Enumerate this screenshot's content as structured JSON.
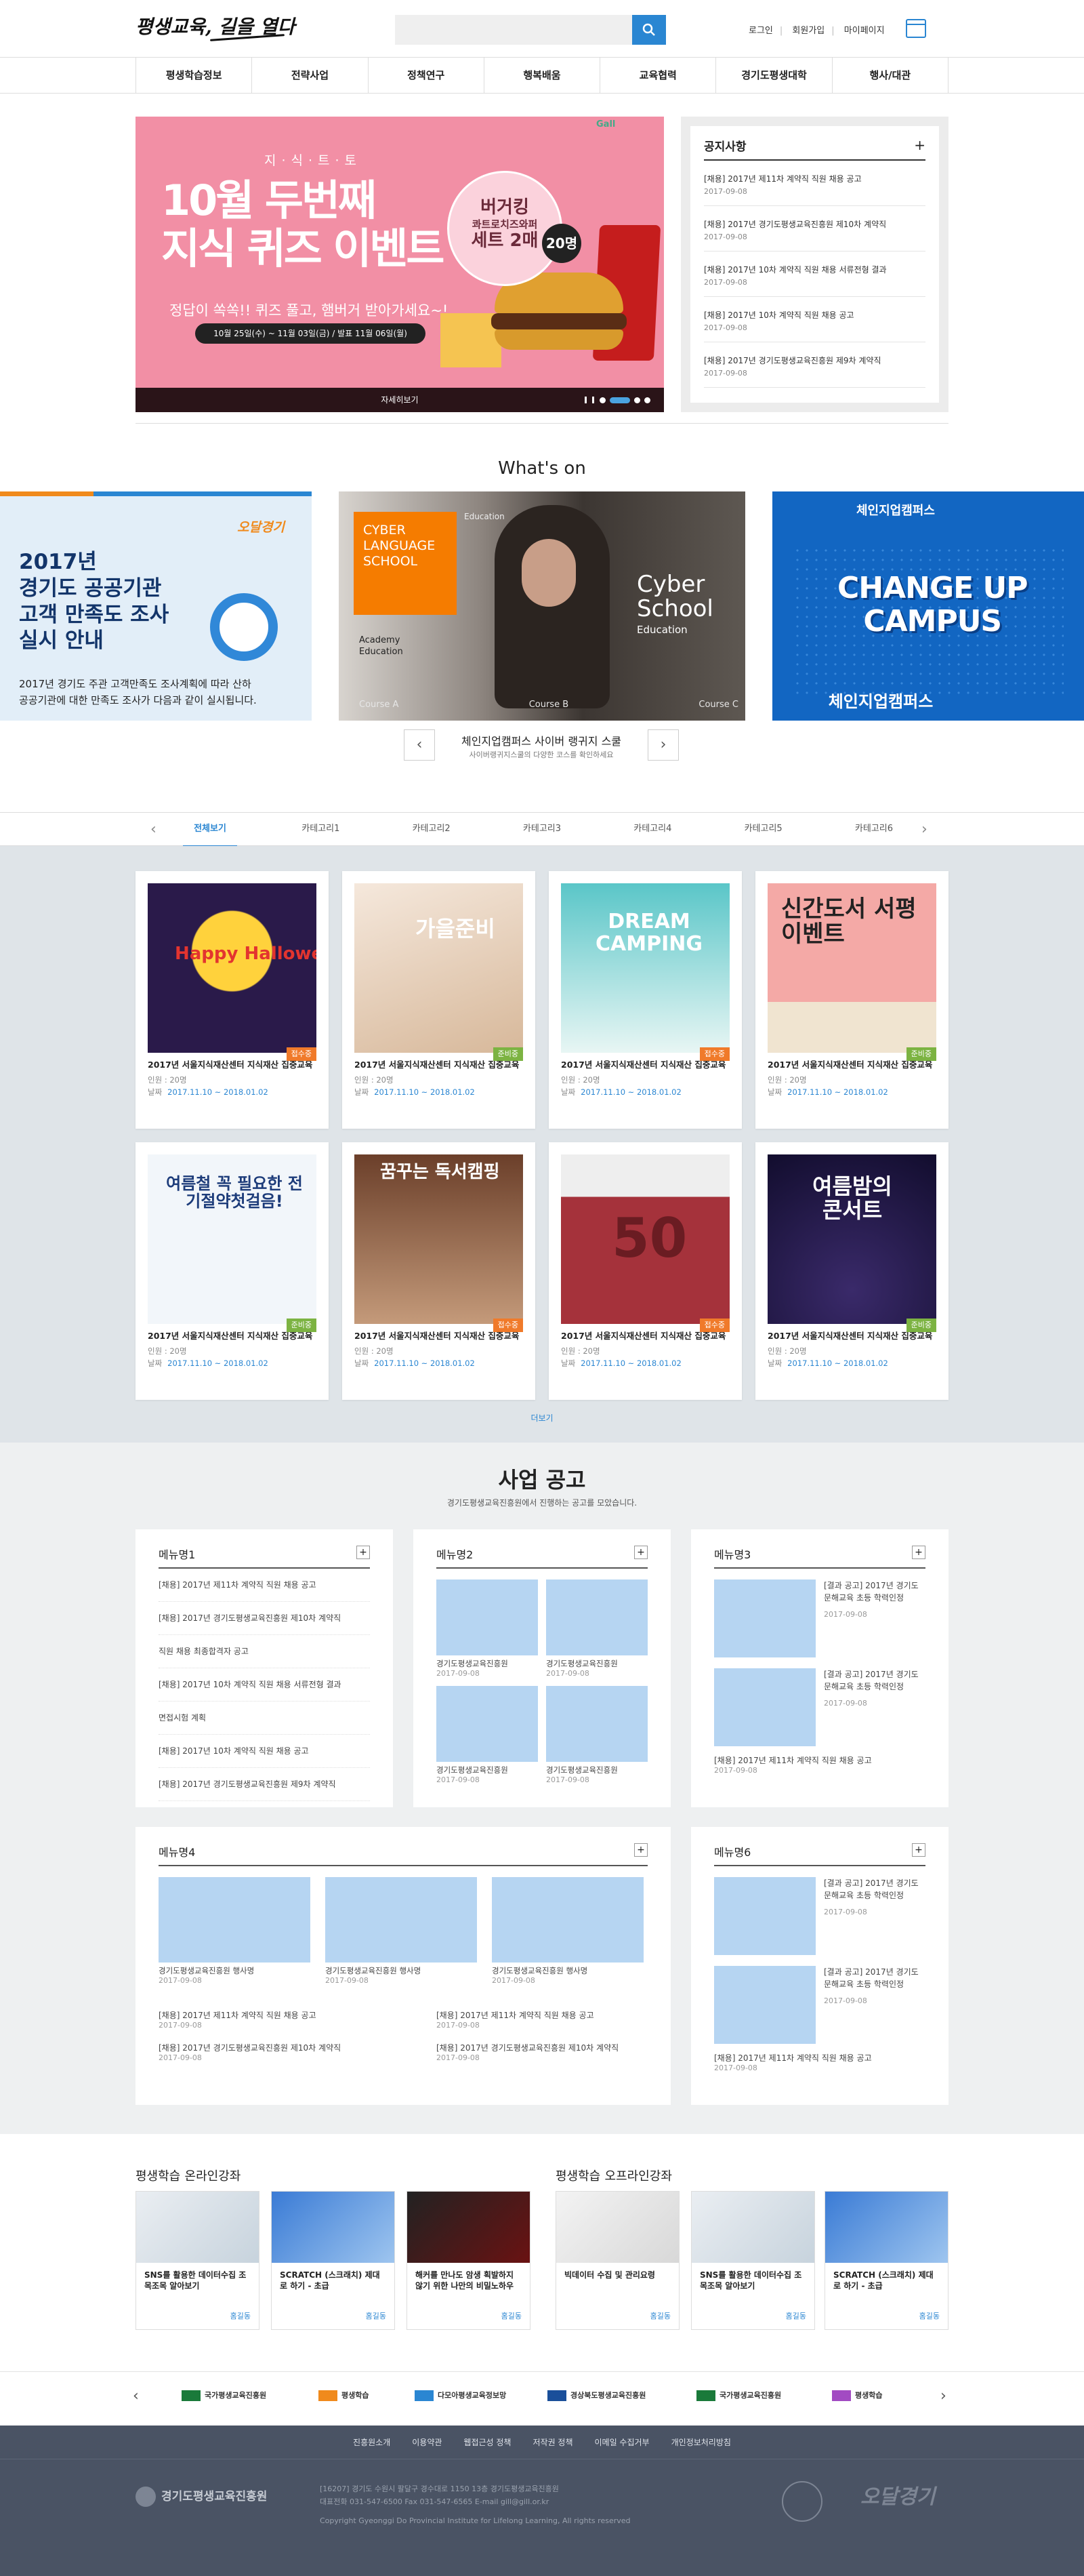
{
  "header": {
    "logo": "평생교육, 길을 열다",
    "search_placeholder": "",
    "links": [
      "로그인",
      "회원가입",
      "마이페이지"
    ]
  },
  "nav": [
    "평생학습정보",
    "전략사업",
    "정책연구",
    "행복배움",
    "교육협력",
    "경기도평생대학",
    "행사/대관"
  ],
  "banner": {
    "sub": "지·식·트·토",
    "title_line1": "10월 두번째",
    "title_line2": "지식 퀴즈 이벤트",
    "tagline": "정답이 쏙쏙!! 퀴즈 풀고, 햄버거 받아가세요~!",
    "period": "10월 25일(수) ~ 11월 03일(금) / 발표 11월 06일(월)",
    "prize_1": "버거킹",
    "prize_2": "콰트로치즈와퍼",
    "prize_3": "세트 2매",
    "prize_count": "20명",
    "brand": "Gall",
    "more": "자세히보기"
  },
  "notice": {
    "title": "공지사항",
    "plus": "+",
    "items": [
      {
        "title": "[채용] 2017년 제11차 계약직 직원 채용 공고",
        "date": "2017-09-08"
      },
      {
        "title": "[채용] 2017년 경기도평생교육진흥원 제10차 계약직",
        "date": "2017-09-08"
      },
      {
        "title": "[채용] 2017년 10차 계약직 직원 채용 서류전형 결과",
        "date": "2017-09-08"
      },
      {
        "title": "[채용] 2017년 10차 계약직 직원 채용 공고",
        "date": "2017-09-08"
      },
      {
        "title": "[채용] 2017년 경기도평생교육진흥원 제9차 계약직",
        "date": "2017-09-08"
      }
    ]
  },
  "whatson": {
    "title": "What's on",
    "left": {
      "logo": "오달경기",
      "title_1": "2017년",
      "title_2": "경기도 공공기관",
      "title_3": "고객 만족도 조사",
      "title_4": "실시 안내",
      "desc_1": "2017년 경기도 주관 고객만족도 조사계획에 따라 산하",
      "desc_2": "공공기관에 대한 만족도 조사가 다음과 같이 실시됩니다."
    },
    "center": {
      "box_1": "CYBER",
      "box_2": "LANGUAGE",
      "box_3": "SCHOOL",
      "edu": "Education",
      "cs_1": "Cyber",
      "cs_2": "School",
      "cs_3": "Education",
      "acad_1": "Academy",
      "acad_2": "Education",
      "course_a": "Course A",
      "course_b": "Course B",
      "course_c": "Course C"
    },
    "right": {
      "top": "체인지업캠퍼스",
      "line_1": "CHANGE UP",
      "line_2": "CAMPUS",
      "bottom": "체인지업캠퍼스"
    },
    "caption": "체인지업캠퍼스 사이버 랭귀지 스쿨",
    "caption_sub": "사이버랭귀지스쿨의 다양한 코스를 확인하세요",
    "prev": "‹",
    "next": "›"
  },
  "tabs": [
    "전체보기",
    "카테고리1",
    "카테고리2",
    "카테고리3",
    "카테고리4",
    "카테고리5",
    "카테고리6"
  ],
  "cards": [
    {
      "img_text": "Happy Halloween",
      "tag": "접수중",
      "title": "2017년 서울지식재산센터 지식재산 집중교육",
      "count": "인원 : 20명",
      "date_label": "날짜",
      "date": "2017.11.10 ~ 2018.01.02"
    },
    {
      "img_text": "가을준비",
      "tag": "준비중",
      "title": "2017년 서울지식재산센터 지식재산 집중교육",
      "count": "인원 : 20명",
      "date_label": "날짜",
      "date": "2017.11.10 ~ 2018.01.02"
    },
    {
      "img_text": "DREAM CAMPING",
      "tag": "접수중",
      "title": "2017년 서울지식재산센터 지식재산 집중교육",
      "count": "인원 : 20명",
      "date_label": "날짜",
      "date": "2017.11.10 ~ 2018.01.02"
    },
    {
      "img_text": "신간도서 서평이벤트",
      "tag": "준비중",
      "title": "2017년 서울지식재산센터 지식재산 집중교육",
      "count": "인원 : 20명",
      "date_label": "날짜",
      "date": "2017.11.10 ~ 2018.01.02"
    },
    {
      "img_text": "여름철 꼭 필요한 전기절약첫걸음!",
      "tag": "준비중",
      "title": "2017년 서울지식재산센터 지식재산 집중교육",
      "count": "인원 : 20명",
      "date_label": "날짜",
      "date": "2017.11.10 ~ 2018.01.02"
    },
    {
      "img_text": "꿈꾸는 독서캠핑",
      "tag": "접수중",
      "title": "2017년 서울지식재산센터 지식재산 집중교육",
      "count": "인원 : 20명",
      "date_label": "날짜",
      "date": "2017.11.10 ~ 2018.01.02"
    },
    {
      "img_text": "50",
      "tag": "접수중",
      "title": "2017년 서울지식재산센터 지식재산 집중교육",
      "count": "인원 : 20명",
      "date_label": "날짜",
      "date": "2017.11.10 ~ 2018.01.02"
    },
    {
      "img_text": "여름밤의 콘서트",
      "tag": "준비중",
      "title": "2017년 서울지식재산센터 지식재산 집중교육",
      "count": "인원 : 20명",
      "date_label": "날짜",
      "date": "2017.11.10 ~ 2018.01.02"
    }
  ],
  "more": "더보기",
  "announce": {
    "title": "사업 공고",
    "sub": "경기도평생교육진흥원에서 진행하는 공고를 모았습니다.",
    "menu1": {
      "title": "메뉴명1",
      "items": [
        "[채용] 2017년 제11차 계약직 직원 채용 공고",
        "[채용] 2017년 경기도평생교육진흥원 제10차 계약직",
        "직원 채용 최종합격자 공고",
        "[채용] 2017년 10차 계약직 직원 채용 서류전형 결과",
        "면접시험 계획",
        "[채용] 2017년 10차 계약직 직원 채용 공고",
        "[채용] 2017년 경기도평생교육진흥원 제9차 계약직"
      ]
    },
    "menu2": {
      "title": "메뉴명2",
      "items": [
        {
          "cap": "경기도평생교육진흥원",
          "date": "2017-09-08"
        },
        {
          "cap": "경기도평생교육진흥원",
          "date": "2017-09-08"
        },
        {
          "cap": "경기도평생교육진흥원",
          "date": "2017-09-08"
        },
        {
          "cap": "경기도평생교육진흥원",
          "date": "2017-09-08"
        }
      ]
    },
    "menu3": {
      "title": "메뉴명3",
      "items": [
        {
          "text": "[결과 공고] 2017년 경기도 문해교육 초등 학력인정",
          "date": "2017-09-08"
        },
        {
          "text": "[결과 공고] 2017년 경기도 문해교육 초등 학력인정",
          "date": "2017-09-08"
        }
      ],
      "foot": "[채용] 2017년 제11차 계약직 직원 채용 공고",
      "foot_date": "2017-09-08"
    },
    "menu4": {
      "title": "메뉴명4",
      "items": [
        {
          "cap": "경기도평생교육진흥원 행사명",
          "date": "2017-09-08"
        },
        {
          "cap": "경기도평생교육진흥원 행사명",
          "date": "2017-09-08"
        },
        {
          "cap": "경기도평생교육진흥원 행사명",
          "date": "2017-09-08"
        }
      ],
      "list": [
        {
          "text": "[채용] 2017년 제11차 계약직 직원 채용 공고",
          "date": "2017-09-08"
        },
        {
          "text": "[채용] 2017년 경기도평생교육진흥원 제10차 계약직",
          "date": "2017-09-08"
        },
        {
          "text": "[채용] 2017년 제11차 계약직 직원 채용 공고",
          "date": "2017-09-08"
        },
        {
          "text": "[채용] 2017년 경기도평생교육진흥원 제10차 계약직",
          "date": "2017-09-08"
        }
      ]
    },
    "menu6": {
      "title": "메뉴명6",
      "items": [
        {
          "text": "[결과 공고] 2017년 경기도 문해교육 초등 학력인정",
          "date": "2017-09-08"
        },
        {
          "text": "[결과 공고] 2017년 경기도 문해교육 초등 학력인정",
          "date": "2017-09-08"
        }
      ],
      "foot": "[채용] 2017년 제11차 계약직 직원 채용 공고",
      "foot_date": "2017-09-08"
    }
  },
  "lectures": {
    "online_title_1": "평생학습",
    "online_title_2": "온라인강좌",
    "offline_title_1": "평생학습",
    "offline_title_2": "오프라인강좌",
    "items": [
      {
        "title": "SNS를 활용한 데이터수집 조목조목 알아보기",
        "btn": "홈길동"
      },
      {
        "title": "SCRATCH (스크래치) 제대로 하기 - 초급",
        "btn": "홈길동"
      },
      {
        "title": "해커를 만나도 암생 획발하지 않기 위한 나만의 비밀노하우",
        "btn": "홈길동"
      },
      {
        "title": "빅데이터 수집 및 관리요령",
        "btn": "홈길동"
      },
      {
        "title": "SNS를 활용한 데이터수집 조목조목 알아보기",
        "btn": "홈길동"
      },
      {
        "title": "SCRATCH (스크래치) 제대로 하기 - 초급",
        "btn": "홈길동"
      }
    ]
  },
  "partners": [
    "국가평생교육진흥원",
    "평생학습",
    "다모아평생교육정보망",
    "경상북도평생교육진흥원",
    "국가평생교육진흥원",
    "평생학습"
  ],
  "footer": {
    "links": [
      "진흥원소개",
      "이용약관",
      "웹접근성 정책",
      "저작권 정책",
      "이메일 수집거부",
      "개인정보처리방침"
    ],
    "logo": "경기도평생교육진흥원",
    "address": "[16207] 경기도 수원시 팔달구 경수대로 1150 13층 경기도평생교육진흥원",
    "contact": "대표전화 031-547-6500 Fax 031-547-6565 E-mail gill@gill.or.kr",
    "copyright": "Copyright Gyeonggi Do Provincial Institute for Lifelong Learning, All rights reserved",
    "mark_2": "오달경기"
  },
  "colors": {
    "accent": "#2a86d2",
    "banner_bg": "#f28fa5",
    "footer_bg": "#4a5364",
    "tag_open": "#f07a2a",
    "tag_ready": "#7cb342",
    "thumb": "#b6d5f2"
  }
}
